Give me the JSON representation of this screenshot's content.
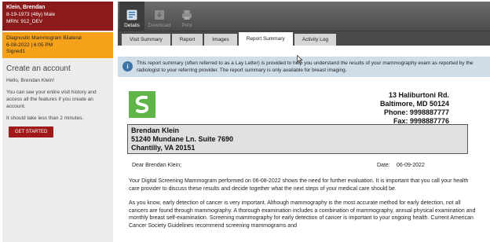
{
  "patient": {
    "name": "Klein, Brendan",
    "dob_line": "8-19-1973 (48y) Male",
    "mrn_line": "MRN: 912_DEV"
  },
  "study": {
    "title": "Diagnostic Mammogram Bilateral",
    "datetime": "6-08-2022 | 6:05 PM",
    "status": "Signed1"
  },
  "account": {
    "heading": "Create an account",
    "greeting": "Hello, Brendan Klein!",
    "body": "You can see your entire visit history and access all the features if you create an account.",
    "time_note": "It should take less than 2 minutes.",
    "button": "GET STARTED"
  },
  "toolbar": {
    "details": "Details",
    "download": "Download",
    "print": "Print"
  },
  "tabs": [
    {
      "label": "Visit Summary"
    },
    {
      "label": "Report"
    },
    {
      "label": "Images"
    },
    {
      "label": "Report Summary"
    },
    {
      "label": "Activity Log"
    }
  ],
  "info": {
    "text": "This report summary (often referred to as a Lay Letter) is provided to help you understand the results of your mammography exam as reported by the radiologist to your referring provider. The report summary is only available for breast imaging."
  },
  "clinic": {
    "line1": "13 Haliburtoni Rd.",
    "line2": "Baltimore, MD 50124",
    "line3": "Phone: 9998887777",
    "line4": "Fax: 9998887776"
  },
  "recipient": {
    "line1": "Brendan Klein",
    "line2": "51240 Mundane Ln. Suite 7690",
    "line3": "Chantilly, VA 20151"
  },
  "letter": {
    "salutation": "Dear Brendan Klein;",
    "date_label": "Date:",
    "date_value": "06-09-2022",
    "para1": "Your Digital Screening Mammogram performed on  06-08-2022 shows the need for further evaluation.   It is important that you call your health care provider to discuss these results and decide together what the next steps of your medical care should be.",
    "para2": "As you know, early detection of cancer is very important.  Although mammography is the most accurate method for early detection, not all cancers are found through mammography.  A thorough examination includes a combination of mammography, annual physical examination and monthly breast self-examination.  Screening mammography for early detection of cancer is important to your ongoing health.  Current American Cancer Society Guidelines recommend screening mammograms and"
  },
  "colors": {
    "patient_bg": "#8b1a1a",
    "study_bg": "#f5a21a",
    "button_bg": "#a11a1a",
    "toolbar_bg": "#5a5a5a",
    "info_bg": "#cfdde9",
    "logo_green": "#5fb548"
  }
}
